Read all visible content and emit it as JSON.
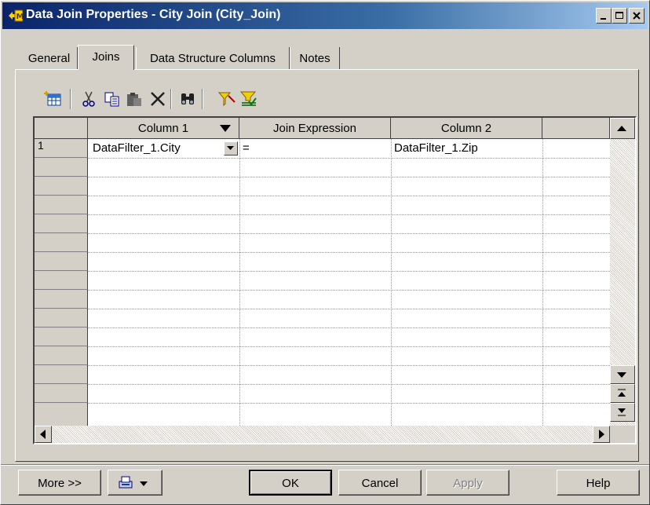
{
  "window": {
    "title": "Data Join Properties - City Join (City_Join)",
    "icon": "data-join-icon",
    "controls": [
      "minimize-icon",
      "maximize-icon",
      "close-icon"
    ]
  },
  "tabs": [
    {
      "label": "General",
      "active": false
    },
    {
      "label": "Joins",
      "active": true
    },
    {
      "label": "Data Structure Columns",
      "active": false
    },
    {
      "label": "Notes",
      "active": false
    }
  ],
  "toolbar": {
    "icons": [
      "add-row-icon",
      "cut-icon",
      "copy-icon",
      "paste-icon",
      "delete-icon",
      "find-icon",
      "filter-icon",
      "customize-columns-icon"
    ]
  },
  "grid": {
    "columns": [
      "Column 1",
      "Join Expression",
      "Column 2"
    ],
    "rows": [
      {
        "num": "1",
        "column1": "DataFilter_1.City",
        "expression": "=",
        "column2": "DataFilter_1.Zip"
      }
    ]
  },
  "buttons": {
    "more": "More >>",
    "ok": "OK",
    "cancel": "Cancel",
    "apply": "Apply",
    "help": "Help"
  },
  "colors": {
    "title_start": "#0a246a",
    "title_end": "#a6caf0",
    "face": "#d4d0c8"
  }
}
